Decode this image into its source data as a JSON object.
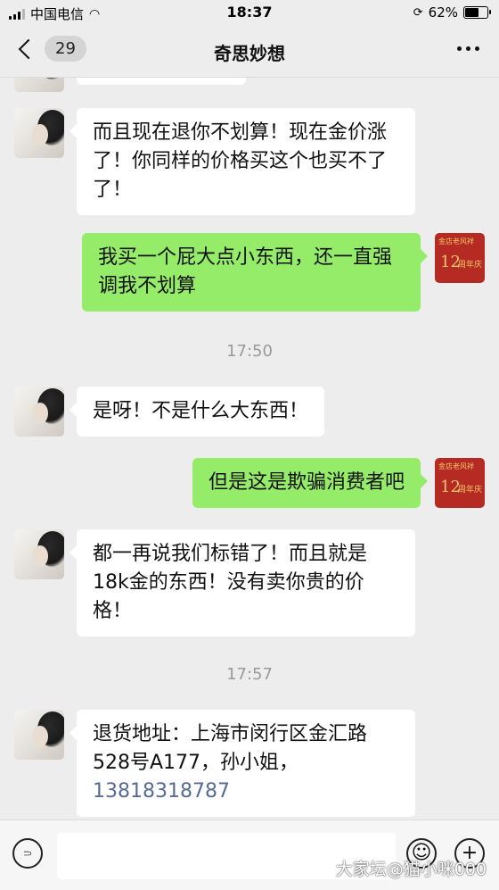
{
  "status_bar": {
    "carrier": "中国电信",
    "time": "18:37",
    "battery": "62%",
    "battery_level": 0.62
  },
  "nav": {
    "back_count": "29",
    "title": "奇思妙想"
  },
  "avatars": {
    "seller_icon": "woman-portrait-avatar",
    "self_top": "金店老风祥",
    "self_num": "12",
    "self_bottom": "周年庆"
  },
  "messages": [
    {
      "side": "left",
      "text": "而且现在退你不划算！现在金价涨了！你同样的价格买这个也买不了了！"
    },
    {
      "side": "right",
      "text": "我买一个屁大点小东西，还一直强调我不划算"
    },
    {
      "type": "time",
      "text": "17:50"
    },
    {
      "side": "left",
      "text": "是呀！不是什么大东西！"
    },
    {
      "side": "right",
      "text": "但是这是欺骗消费者吧"
    },
    {
      "side": "left",
      "text": "都一再说我们标错了！而且就是18k金的东西！没有卖你贵的价格！"
    },
    {
      "type": "time",
      "text": "17:57"
    },
    {
      "side": "left",
      "text": "退货地址：上海市闵行区金汇路528号A177，孙小姐，",
      "link": "13818318787"
    }
  ],
  "input_bar": {
    "watermark": "大家坛@猫小咪000"
  }
}
